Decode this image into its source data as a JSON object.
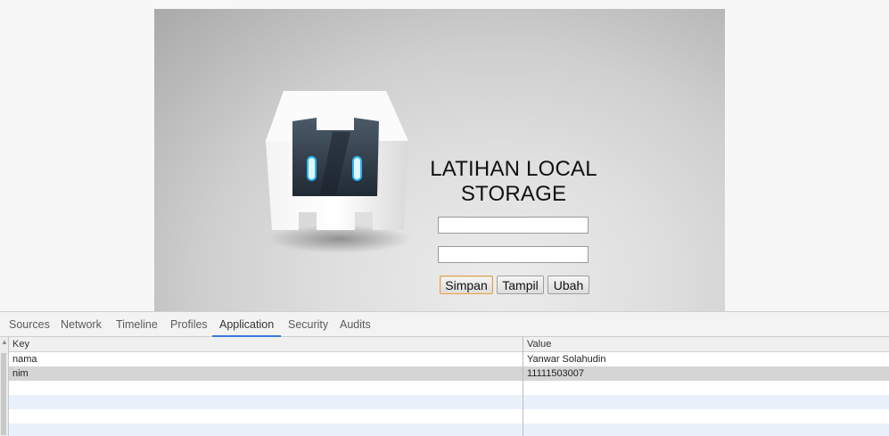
{
  "app": {
    "title_line1": "LATIHAN LOCAL",
    "title_line2": "STORAGE",
    "input1_value": "",
    "input2_value": "",
    "buttons": {
      "save": "Simpan",
      "show": "Tampil",
      "edit": "Ubah"
    }
  },
  "devtools": {
    "tabs": [
      "Sources",
      "Network",
      "Timeline",
      "Profiles",
      "Application",
      "Security",
      "Audits"
    ],
    "active_tab": "Application",
    "accent_color": "#3879d9",
    "table": {
      "columns": [
        "Key",
        "Value"
      ],
      "rows": [
        {
          "key": "nama",
          "value": "Yanwar Solahudin"
        },
        {
          "key": "nim",
          "value": "11111503007"
        }
      ]
    }
  }
}
